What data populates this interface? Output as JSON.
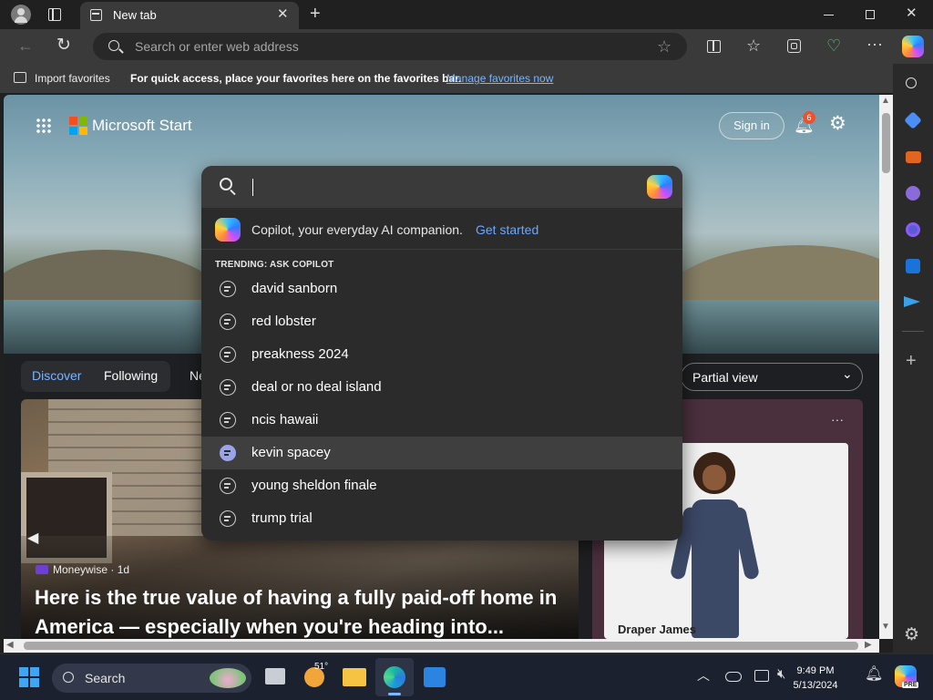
{
  "browser": {
    "tab_title": "New tab",
    "address_placeholder": "Search or enter web address",
    "favorites_bar": {
      "import_label": "Import favorites",
      "hint": "For quick access, place your favorites here on the favorites bar.",
      "manage_link": "Manage favorites now"
    }
  },
  "page": {
    "brand": "Microsoft Start",
    "sign_in": "Sign in",
    "notification_count": "6",
    "feed_tabs": [
      "Discover",
      "Following",
      "Ne"
    ],
    "view_select": "Partial view",
    "main_card": {
      "source": "Moneywise · 1d",
      "headline": "Here is the true value of having a fully paid-off home in America — especially when you're heading into..."
    },
    "ad_card": {
      "brand": "Draper James"
    }
  },
  "search_dropdown": {
    "copilot_text": "Copilot, your everyday AI companion.",
    "copilot_link": "Get started",
    "trending_label": "TRENDING: ASK COPILOT",
    "items": [
      "david sanborn",
      "red lobster",
      "preakness 2024",
      "deal or no deal island",
      "ncis hawaii",
      "kevin spacey",
      "young sheldon finale",
      "trump trial"
    ],
    "highlighted_index": 5
  },
  "taskbar": {
    "search_label": "Search",
    "weather_temp": "51°",
    "time": "9:49 PM",
    "date": "5/13/2024",
    "copilot_badge": "PRE"
  },
  "colors": {
    "accent_blue": "#6aa7ff",
    "notification_badge": "#e8542f"
  }
}
